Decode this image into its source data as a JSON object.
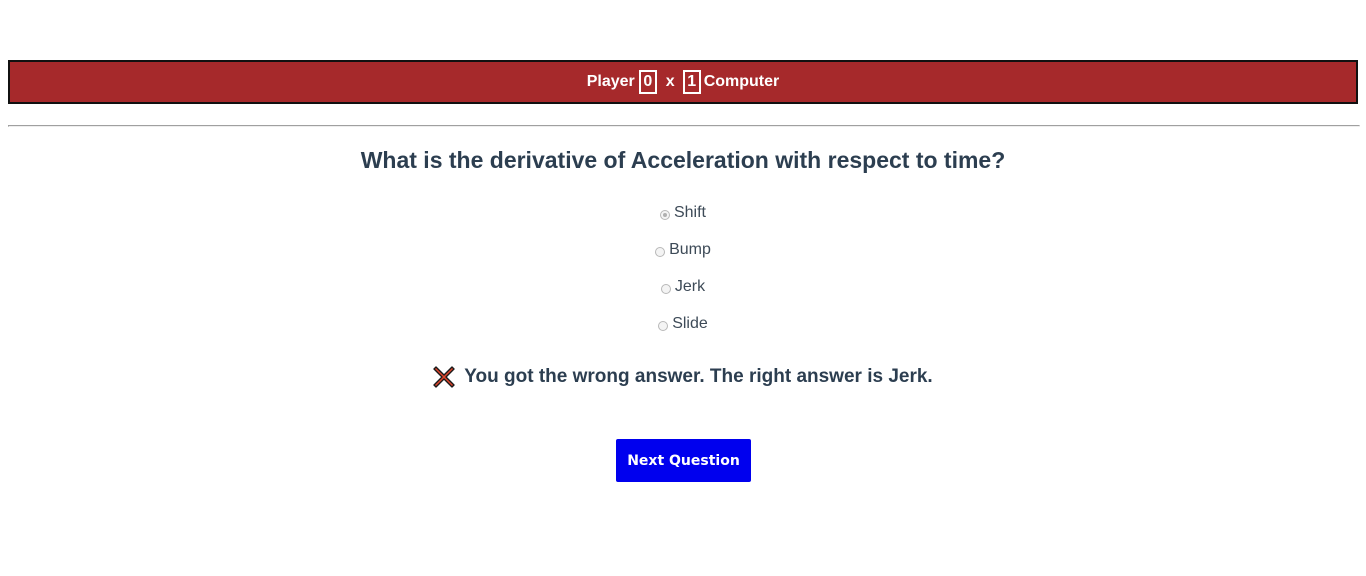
{
  "scoreboard": {
    "player_label": "Player",
    "player_score": "0",
    "separator": "x",
    "computer_score": "1",
    "computer_label": "Computer"
  },
  "question": {
    "text": "What is the derivative of Acceleration with respect to time?",
    "options": [
      {
        "label": "Shift",
        "selected": true
      },
      {
        "label": "Bump",
        "selected": false
      },
      {
        "label": "Jerk",
        "selected": false
      },
      {
        "label": "Slide",
        "selected": false
      }
    ]
  },
  "feedback": {
    "icon": "cross-icon",
    "text": "You got the wrong answer. The right answer is Jerk."
  },
  "next_button": {
    "label": "Next Question"
  },
  "colors": {
    "scorebar_bg": "#a6292b",
    "button_bg": "#0000ee",
    "wrong_icon": "#e0452b"
  }
}
